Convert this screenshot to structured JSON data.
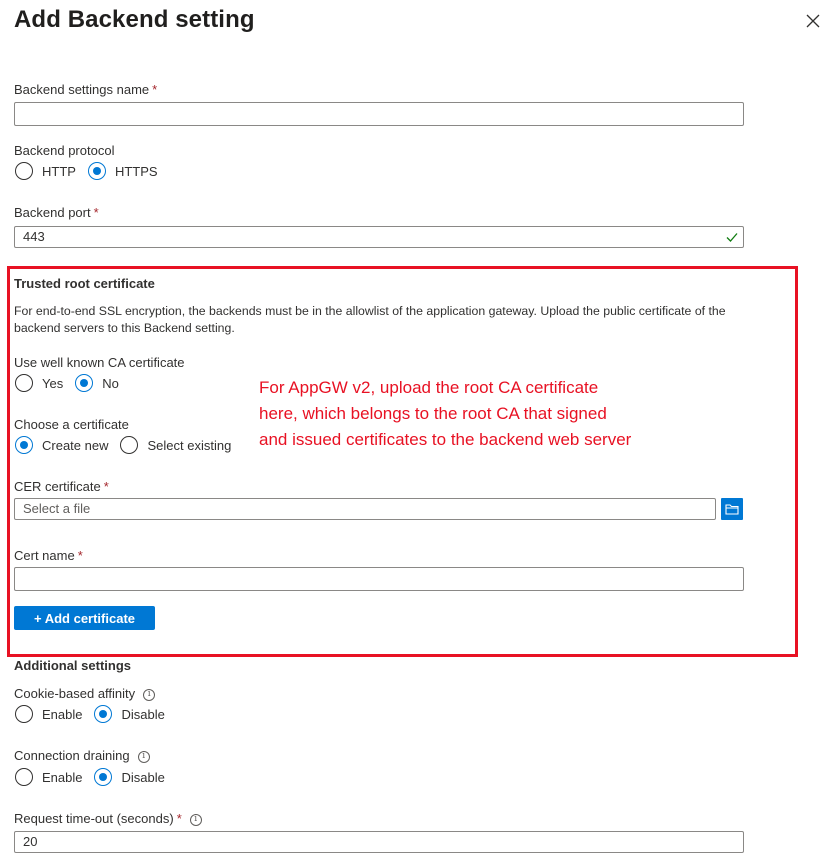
{
  "header": {
    "title": "Add Backend setting",
    "close_icon": "close-icon"
  },
  "form": {
    "name": {
      "label": "Backend settings name",
      "required_mark": "*",
      "value": ""
    },
    "protocol": {
      "label": "Backend protocol",
      "options": [
        "HTTP",
        "HTTPS"
      ],
      "selected": "HTTPS"
    },
    "port": {
      "label": "Backend port",
      "required_mark": "*",
      "value": "443",
      "valid_icon": "checkmark-icon"
    }
  },
  "trusted_root": {
    "heading": "Trusted root certificate",
    "description": "For end-to-end SSL encryption, the backends must be in the allowlist of the application gateway. Upload the public certificate of the backend servers to this Backend setting.",
    "well_known": {
      "label": "Use well known CA certificate",
      "options": [
        "Yes",
        "No"
      ],
      "selected": "No"
    },
    "choose": {
      "label": "Choose a certificate",
      "options": [
        "Create new",
        "Select existing"
      ],
      "selected": "Create new"
    },
    "cer": {
      "label": "CER certificate",
      "required_mark": "*",
      "placeholder": "Select a file",
      "browse_icon": "folder-icon"
    },
    "cert_name": {
      "label": "Cert name",
      "required_mark": "*",
      "value": ""
    },
    "add_button": "+ Add certificate",
    "annotation": "For AppGW v2, upload the root CA certificate here, which belongs to the root CA that signed and issued certificates to the backend web server"
  },
  "additional": {
    "heading": "Additional settings",
    "cookie": {
      "label": "Cookie-based affinity",
      "options": [
        "Enable",
        "Disable"
      ],
      "selected": "Disable"
    },
    "draining": {
      "label": "Connection draining",
      "options": [
        "Enable",
        "Disable"
      ],
      "selected": "Disable"
    },
    "timeout": {
      "label": "Request time-out (seconds)",
      "required_mark": "*",
      "value": "20"
    }
  },
  "colors": {
    "accent": "#0078d4",
    "annotation": "#e81123",
    "required": "#a4262c",
    "valid": "#107c10"
  }
}
